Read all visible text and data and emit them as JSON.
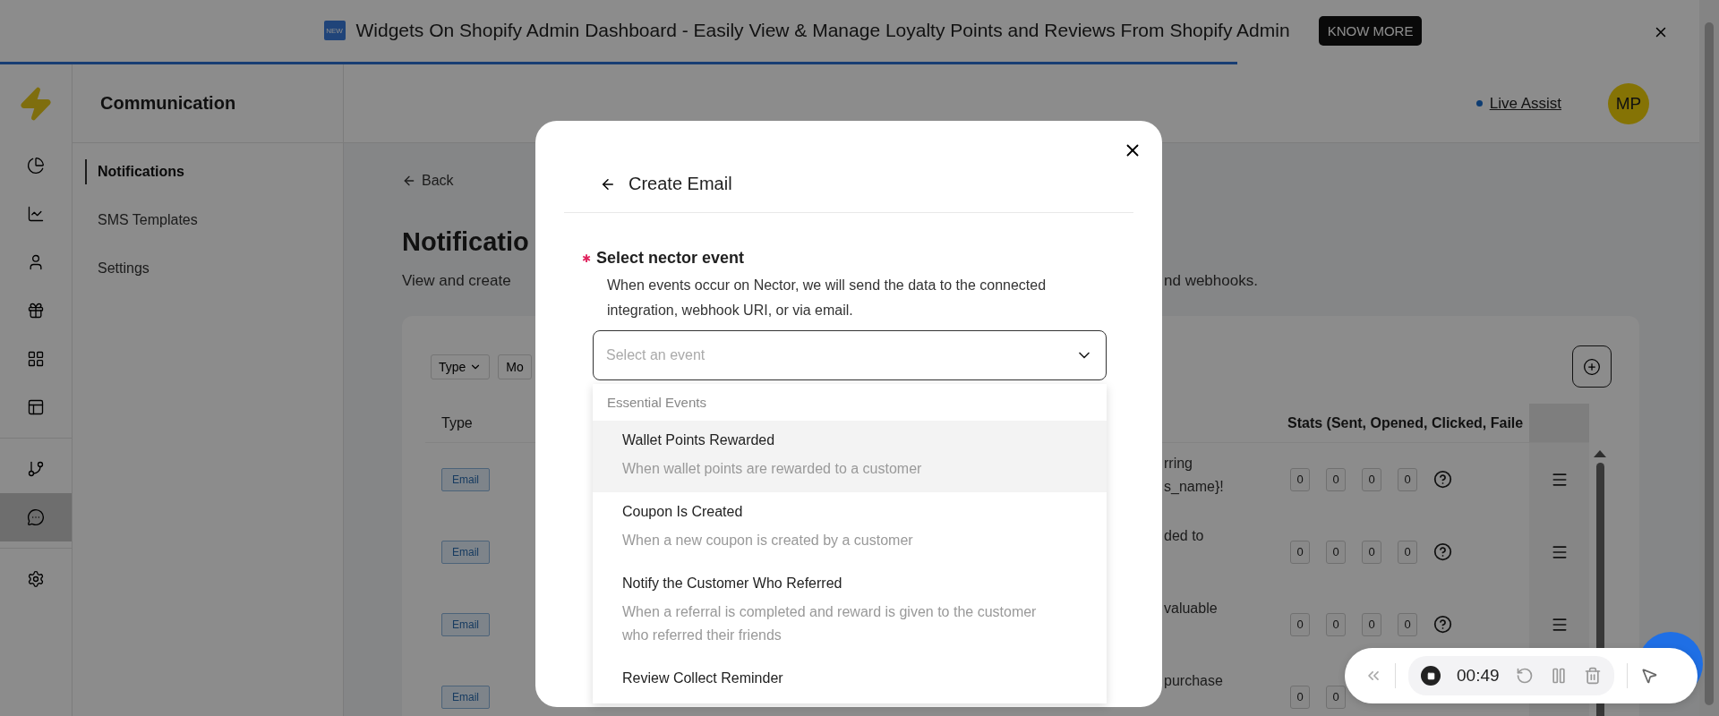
{
  "banner": {
    "badge": "NEW",
    "text": "Widgets On Shopify Admin Dashboard - Easily View & Manage Loyalty Points and Reviews From Shopify Admin",
    "button": "KNOW MORE",
    "level": 0.72
  },
  "rail": {
    "items": [
      {
        "kind": "pie",
        "selected": false
      },
      {
        "kind": "chart",
        "selected": false
      },
      {
        "kind": "user",
        "selected": false
      },
      {
        "kind": "gift",
        "selected": false
      },
      {
        "kind": "grid",
        "selected": false
      },
      {
        "kind": "layout",
        "selected": false
      },
      {
        "kind": "branch",
        "selected": false
      },
      {
        "kind": "chat",
        "selected": true
      },
      {
        "kind": "settings",
        "selected": false
      }
    ]
  },
  "sidebar": {
    "title": "Communication",
    "items": [
      {
        "label": "Notifications",
        "selected": true
      },
      {
        "label": "SMS Templates",
        "selected": false
      },
      {
        "label": "Settings",
        "selected": false
      }
    ]
  },
  "header": {
    "live_assist": "Live Assist",
    "avatar": "MP"
  },
  "page": {
    "back": "Back",
    "title": "Notificatio",
    "description_start": "View and create",
    "description_end": "nd webhooks.",
    "filters": [
      "Type",
      "Mo"
    ],
    "columns": {
      "type": "Type",
      "stats": "Stats (Sent, Opened, Clicked, Faile"
    },
    "rows": [
      {
        "type": "Email",
        "fragment": [
          "rring",
          "s_name}!"
        ],
        "stats": [
          "0",
          "0",
          "0",
          "0"
        ]
      },
      {
        "type": "Email",
        "fragment": [
          "ded to"
        ],
        "stats": [
          "0",
          "0",
          "0",
          "0"
        ]
      },
      {
        "type": "Email",
        "fragment": [
          "valuable"
        ],
        "stats": [
          "0",
          "0",
          "0",
          "0"
        ]
      },
      {
        "type": "Email",
        "fragment": [
          "purchase"
        ],
        "stats": [
          "0",
          "0"
        ]
      }
    ]
  },
  "modal": {
    "title": "Create Email",
    "required": true,
    "required_mark": "✱",
    "field_label": "Select nector event",
    "help": "When events occur on Nector, we will send the data to the connected integration, webhook URI, or via email.",
    "placeholder": "Select an event",
    "group": "Essential Events",
    "options": [
      {
        "title": "Wallet Points Rewarded",
        "description": "When wallet points are rewarded to a customer",
        "selected": true
      },
      {
        "title": "Coupon Is Created",
        "description": "When a new coupon is created by a customer",
        "selected": false
      },
      {
        "title": "Notify the Customer Who Referred",
        "description": "When a referral is completed and reward is given to the customer who referred their friends",
        "selected": false
      },
      {
        "title": "Review Collect Reminder",
        "selected": false
      }
    ]
  },
  "recorder": {
    "time": "00:49"
  }
}
